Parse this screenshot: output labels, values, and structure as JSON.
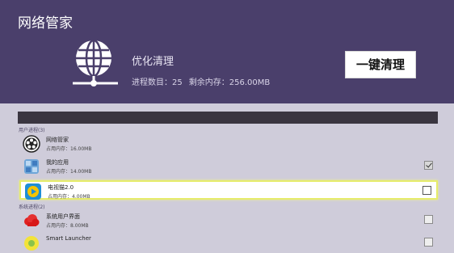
{
  "header": {
    "app_title": "网络管家",
    "optimize_title": "优化清理",
    "process_count_label": "进程数目：",
    "process_count": "25",
    "memory_label": "剩余内存：",
    "memory_value": "256.00MB",
    "clean_button": "一键清理",
    "icon": "globe-network-icon",
    "colors": {
      "header_bg": "#4a3f6b",
      "list_bg": "#cfccda",
      "highlight_border": "#e6ec6a"
    }
  },
  "sections": {
    "user_process": "用户进程(3)",
    "system_process": "系统进程(2)"
  },
  "user_apps": [
    {
      "name": "网络管家",
      "memory": "占用内存：16.00MB",
      "icon": "film-reel-icon",
      "checked": false,
      "show_check": false
    },
    {
      "name": "我的应用",
      "memory": "占用内存：14.00MB",
      "icon": "app-cubes-icon",
      "checked": true,
      "show_check": true
    },
    {
      "name": "电视猫2.0",
      "memory": "占用内存：4.00MB",
      "icon": "tv-play-icon",
      "checked": false,
      "show_check": true,
      "selected": true
    }
  ],
  "system_apps": [
    {
      "name": "系统用户界面",
      "memory": "占用内存：8.00MB",
      "icon": "cloud-icon",
      "checked": false,
      "show_check": true
    },
    {
      "name": "Smart Launcher",
      "memory": "",
      "icon": "launcher-icon",
      "checked": false,
      "show_check": true
    }
  ]
}
